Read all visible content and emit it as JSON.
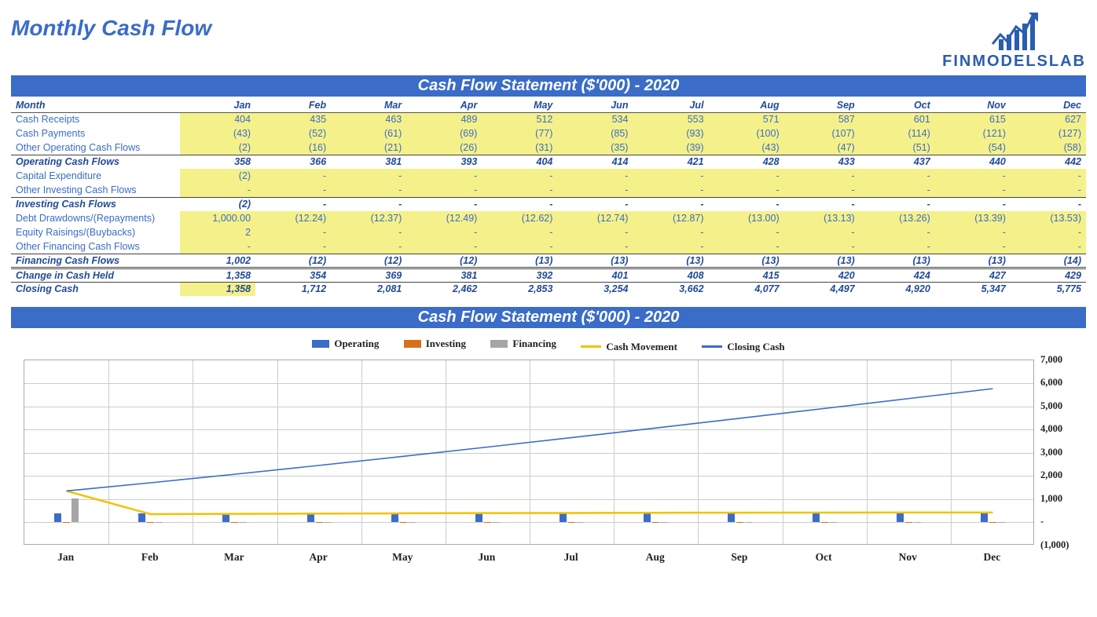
{
  "page_title": "Monthly Cash Flow",
  "brand": "FINMODELSLAB",
  "banner1": "Cash Flow Statement ($'000) - 2020",
  "banner2": "Cash Flow Statement ($'000) - 2020",
  "header_label": "Month",
  "months": [
    "Jan",
    "Feb",
    "Mar",
    "Apr",
    "May",
    "Jun",
    "Jul",
    "Aug",
    "Sep",
    "Oct",
    "Nov",
    "Dec"
  ],
  "rows": [
    {
      "key": "receipts",
      "label": "Cash Receipts",
      "class": "yellow",
      "vals": [
        "404",
        "435",
        "463",
        "489",
        "512",
        "534",
        "553",
        "571",
        "587",
        "601",
        "615",
        "627"
      ]
    },
    {
      "key": "payments",
      "label": "Cash Payments",
      "class": "yellow",
      "vals": [
        "(43)",
        "(52)",
        "(61)",
        "(69)",
        "(77)",
        "(85)",
        "(93)",
        "(100)",
        "(107)",
        "(114)",
        "(121)",
        "(127)"
      ]
    },
    {
      "key": "ot_op",
      "label": "Other Operating Cash Flows",
      "class": "yellow",
      "vals": [
        "(2)",
        "(16)",
        "(21)",
        "(26)",
        "(31)",
        "(35)",
        "(39)",
        "(43)",
        "(47)",
        "(51)",
        "(54)",
        "(58)"
      ]
    },
    {
      "key": "op_cf",
      "label": "Operating Cash Flows",
      "class": "subtot",
      "vals": [
        "358",
        "366",
        "381",
        "393",
        "404",
        "414",
        "421",
        "428",
        "433",
        "437",
        "440",
        "442"
      ]
    },
    {
      "key": "capex",
      "label": "Capital Expenditure",
      "class": "yellow",
      "vals": [
        "(2)",
        "-",
        "-",
        "-",
        "-",
        "-",
        "-",
        "-",
        "-",
        "-",
        "-",
        "-"
      ]
    },
    {
      "key": "ot_inv",
      "label": "Other Investing Cash Flows",
      "class": "yellow",
      "vals": [
        "-",
        "-",
        "-",
        "-",
        "-",
        "-",
        "-",
        "-",
        "-",
        "-",
        "-",
        "-"
      ]
    },
    {
      "key": "inv_cf",
      "label": "Investing Cash Flows",
      "class": "subtot",
      "vals": [
        "(2)",
        "-",
        "-",
        "-",
        "-",
        "-",
        "-",
        "-",
        "-",
        "-",
        "-",
        "-"
      ]
    },
    {
      "key": "debt",
      "label": "Debt Drawdowns/(Repayments)",
      "class": "yellow",
      "vals": [
        "1,000.00",
        "(12.24)",
        "(12.37)",
        "(12.49)",
        "(12.62)",
        "(12.74)",
        "(12.87)",
        "(13.00)",
        "(13.13)",
        "(13.26)",
        "(13.39)",
        "(13.53)"
      ]
    },
    {
      "key": "equity",
      "label": "Equity Raisings/(Buybacks)",
      "class": "yellow",
      "vals": [
        "2",
        "-",
        "-",
        "-",
        "-",
        "-",
        "-",
        "-",
        "-",
        "-",
        "-",
        "-"
      ]
    },
    {
      "key": "ot_fin",
      "label": "Other Financing Cash Flows",
      "class": "yellow",
      "vals": [
        "-",
        "-",
        "-",
        "-",
        "-",
        "-",
        "-",
        "-",
        "-",
        "-",
        "-",
        "-"
      ]
    },
    {
      "key": "fin_cf",
      "label": "Financing Cash Flows",
      "class": "subtot",
      "vals": [
        "1,002",
        "(12)",
        "(12)",
        "(12)",
        "(13)",
        "(13)",
        "(13)",
        "(13)",
        "(13)",
        "(13)",
        "(13)",
        "(14)"
      ]
    },
    {
      "key": "change",
      "label": "Change in Cash Held",
      "class": "subtot dbltop",
      "vals": [
        "1,358",
        "354",
        "369",
        "381",
        "392",
        "401",
        "408",
        "415",
        "420",
        "424",
        "427",
        "429"
      ]
    },
    {
      "key": "closing",
      "label": "Closing Cash",
      "class": "closing topline",
      "vals": [
        "1,358",
        "1,712",
        "2,081",
        "2,462",
        "2,853",
        "3,254",
        "3,662",
        "4,077",
        "4,497",
        "4,920",
        "5,347",
        "5,775"
      ]
    }
  ],
  "legend": {
    "operating": "Operating",
    "investing": "Investing",
    "financing": "Financing",
    "cashmove": "Cash Movement",
    "closing": "Closing Cash"
  },
  "chart_data": {
    "type": "bar+line",
    "categories": [
      "Jan",
      "Feb",
      "Mar",
      "Apr",
      "May",
      "Jun",
      "Jul",
      "Aug",
      "Sep",
      "Oct",
      "Nov",
      "Dec"
    ],
    "series": [
      {
        "name": "Operating",
        "kind": "bar",
        "color": "#3a6cc8",
        "values": [
          358,
          366,
          381,
          393,
          404,
          414,
          421,
          428,
          433,
          437,
          440,
          442
        ]
      },
      {
        "name": "Investing",
        "kind": "bar",
        "color": "#d86f1a",
        "values": [
          -2,
          0,
          0,
          0,
          0,
          0,
          0,
          0,
          0,
          0,
          0,
          0
        ]
      },
      {
        "name": "Financing",
        "kind": "bar",
        "color": "#a6a6a6",
        "values": [
          1002,
          -12,
          -12,
          -12,
          -13,
          -13,
          -13,
          -13,
          -13,
          -13,
          -13,
          -14
        ]
      },
      {
        "name": "Cash Movement",
        "kind": "line",
        "color": "#f2c200",
        "values": [
          1358,
          354,
          369,
          381,
          392,
          401,
          408,
          415,
          420,
          424,
          427,
          429
        ]
      },
      {
        "name": "Closing Cash",
        "kind": "line",
        "color": "#3a6cc8",
        "values": [
          1358,
          1712,
          2081,
          2462,
          2853,
          3254,
          3662,
          4077,
          4497,
          4920,
          5347,
          5775
        ]
      }
    ],
    "ylim": [
      -1000,
      7000
    ],
    "yticks": [
      "7,000",
      "6,000",
      "5,000",
      "4,000",
      "3,000",
      "2,000",
      "1,000",
      "-",
      "(1,000)"
    ],
    "title": "Cash Flow Statement ($'000) - 2020"
  }
}
